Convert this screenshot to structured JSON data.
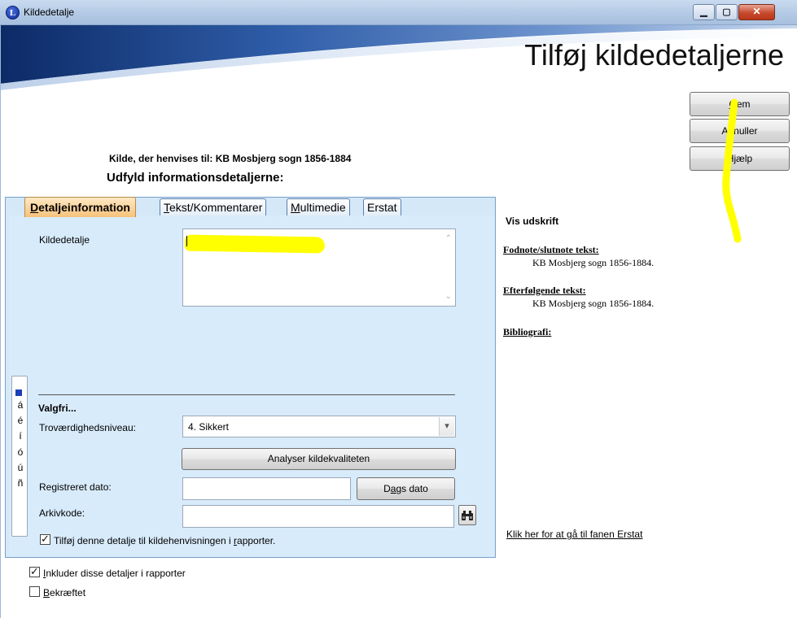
{
  "window": {
    "title": "Kildedetalje",
    "icon_letter": "L",
    "buttons": {
      "minimize": "▭",
      "maximize": "□",
      "close": "✕"
    }
  },
  "header": {
    "title": "Tilføj kildedetaljerne"
  },
  "actions": {
    "save_label_pre": "",
    "save_label_u": "G",
    "save_label_post": "em",
    "cancel_label": "Annuller",
    "help_label_pre": "H",
    "help_label_u": "j",
    "help_label_post": "ælp"
  },
  "source": {
    "line": "Kilde, der henvises til: KB Mosbjerg sogn 1856-1884"
  },
  "instructions": "Udfyld informationsdetaljerne:",
  "tabs": [
    {
      "u": "D",
      "rest": "etaljeinformation"
    },
    {
      "u": "T",
      "rest": "ekst/Kommentarer"
    },
    {
      "u": "M",
      "rest": "ultimedie"
    },
    {
      "u": "",
      "rest": "Erstat"
    }
  ],
  "form": {
    "detail_label": "Kildedetalje",
    "detail_value": "",
    "optional_heading": "Valgfri...",
    "quality_label": "Troværdighedsniveau:",
    "quality_value": "4.  Sikkert",
    "analyse_button": "Analyser kildekvaliteten",
    "date_label": "Registreret dato:",
    "date_value": "",
    "today_button_pre": "D",
    "today_button_u": "a",
    "today_button_post": "gs dato",
    "archive_label": "Arkivkode:",
    "archive_value": "",
    "binoculars_icon": "binoculars-icon",
    "add_to_reports_pre": "Tilføj denne detalje til kildehenvisningen i ",
    "add_to_reports_u": "r",
    "add_to_reports_post": "apporter.",
    "add_to_reports_checked": true
  },
  "accents": [
    "á",
    "é",
    "í",
    "ó",
    "ú",
    "ñ"
  ],
  "bottom_checks": {
    "include_u": "I",
    "include_rest": "nkluder disse detaljer i rapporter",
    "include_checked": true,
    "confirmed_u": "B",
    "confirmed_rest": "ekræftet",
    "confirmed_checked": false
  },
  "preview": {
    "title": "Vis udskrift",
    "footnote_label": "Fodnote/slutnote tekst:",
    "footnote_text": "KB Mosbjerg sogn 1856-1884.",
    "subsequent_label": "Efterfølgende tekst:",
    "subsequent_text": "KB Mosbjerg sogn 1856-1884.",
    "bibliography_label": "Bibliografi:",
    "link": "Klik her for at gå til fanen Erstat"
  },
  "colors": {
    "accent_highlight": "#ffff00",
    "panel_bg": "#d4e8f8",
    "active_tab": "#f6c27a"
  }
}
